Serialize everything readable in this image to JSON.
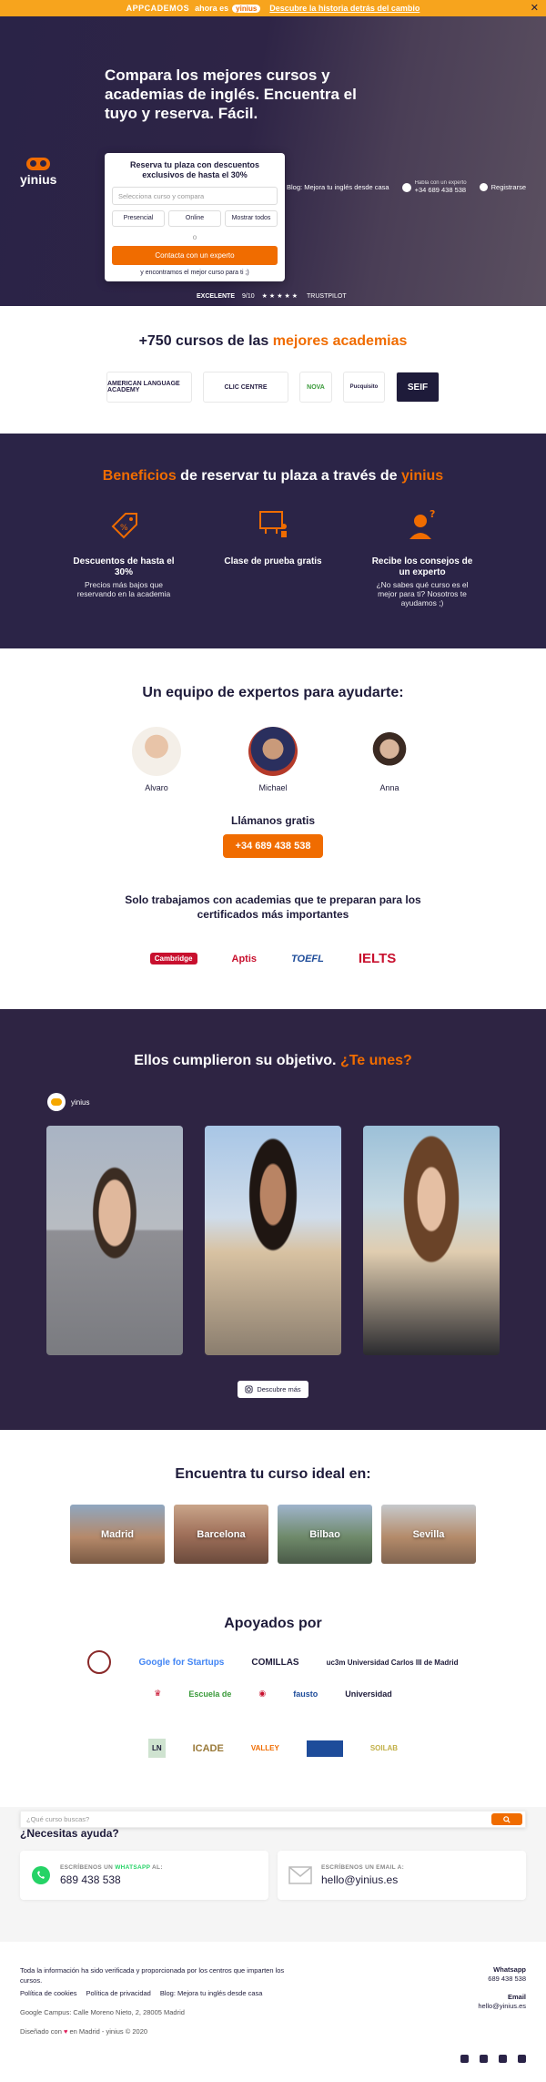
{
  "topbar": {
    "brand": "APPCADEMOS",
    "ahora": "ahora es",
    "yinius_mini": "yinius",
    "link": "Descubre la historia detrás del cambio",
    "close": "✕"
  },
  "hero": {
    "logo": "yinius",
    "title": "Compara los mejores cursos y academias de inglés. Encuentra el tuyo y reserva. Fácil.",
    "nav": {
      "blog": "Blog: Mejora tu inglés desde casa",
      "phone_small": "Habla con un experto",
      "phone": "+34 689 438 538",
      "register": "Registrarse"
    },
    "card": {
      "title": "Reserva tu plaza con descuentos exclusivos de hasta el 30%",
      "placeholder": "Selecciona curso y compara",
      "options": [
        "Presencial",
        "Online",
        "Mostrar todos"
      ],
      "or": "o",
      "cta": "Contacta con un experto",
      "note": "y encontramos el mejor curso para ti ;)"
    },
    "rating": {
      "label": "EXCELENTE",
      "score": "9/10",
      "stars": "★★★★★",
      "provider": "TRUSTPILOT"
    }
  },
  "academies": {
    "title_a": "+750 cursos de las ",
    "title_b": "mejores academias",
    "logos": [
      "AMERICAN LANGUAGE ACADEMY",
      "CLIC CENTRE",
      "NOVA",
      "Pucquisito",
      "SEIF"
    ]
  },
  "benefits": {
    "title_a": "Beneficios",
    "title_b": " de reservar tu plaza a través de ",
    "title_c": "yinius",
    "items": [
      {
        "title": "Descuentos de hasta el 30%",
        "desc": "Precios más bajos que reservando en la academia"
      },
      {
        "title": "Clase de prueba gratis",
        "desc": ""
      },
      {
        "title": "Recibe los consejos de un experto",
        "desc": "¿No sabes qué curso es el mejor para ti? Nosotros te ayudamos ;)"
      }
    ]
  },
  "team": {
    "title": "Un equipo de expertos para ayudarte:",
    "experts": [
      "Alvaro",
      "Michael",
      "Anna"
    ],
    "call_title": "Llámanos gratis",
    "call_btn": "+34 689 438 538",
    "certs_title": "Solo trabajamos con academias que te preparan para los certificados más importantes",
    "certs": [
      "Cambridge",
      "Aptis",
      "TOEFL",
      "IELTS"
    ]
  },
  "stories": {
    "title_a": "Ellos cumplieron su objetivo. ",
    "title_b": "¿Te unes?",
    "tag": "yinius",
    "more": "Descubre más"
  },
  "cities": {
    "title": "Encuentra tu curso ideal en:",
    "items": [
      "Madrid",
      "Barcelona",
      "Bilbao",
      "Sevilla"
    ]
  },
  "backed": {
    "title": "Apoyados por",
    "row1": [
      "Google for Startups",
      "COMILLAS",
      "uc3m Universidad Carlos III de Madrid"
    ],
    "row2": [
      "Escuela de",
      "fausto",
      "Universidad"
    ],
    "row3": [
      "LN",
      "ICADE",
      "VALLEY",
      "SOILAB"
    ],
    "search_placeholder": "¿Qué curso buscas?"
  },
  "help": {
    "title": "¿Necesitas ayuda?",
    "wa_key_a": "ESCRÍBENOS UN ",
    "wa_key_b": "WHATSAPP",
    "wa_key_c": " AL:",
    "wa_value": "689 438 538",
    "email_key": "ESCRÍBENOS UN EMAIL A:",
    "email_value": "hello@yinius.es"
  },
  "footer": {
    "disclaimer": "Toda la información ha sido verificada y proporcionada por los centros que imparten los cursos.",
    "links": [
      "Política de cookies",
      "Política de privacidad",
      "Blog: Mejora tu inglés desde casa"
    ],
    "address": "Google Campus: Calle Moreno Nieto, 2, 28005 Madrid",
    "made_a": "Diseñado con ",
    "made_b": " en Madrid - yinius © 2020",
    "wa_label": "Whatsapp",
    "wa": "689 438 538",
    "email_label": "Email",
    "email": "hello@yinius.es"
  },
  "colors": {
    "accent": "#f06c00",
    "dark": "#2b2447"
  }
}
